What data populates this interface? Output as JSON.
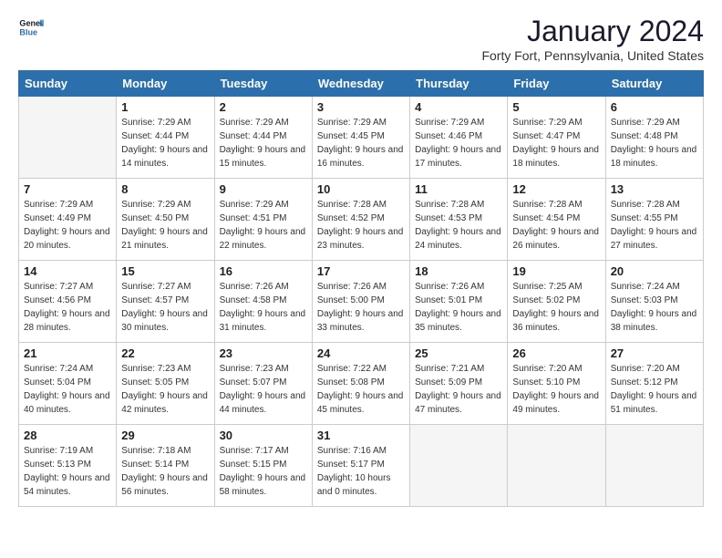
{
  "logo": {
    "line1": "General",
    "line2": "Blue"
  },
  "title": "January 2024",
  "location": "Forty Fort, Pennsylvania, United States",
  "days_of_week": [
    "Sunday",
    "Monday",
    "Tuesday",
    "Wednesday",
    "Thursday",
    "Friday",
    "Saturday"
  ],
  "weeks": [
    [
      {
        "day": "",
        "sunrise": "",
        "sunset": "",
        "daylight": ""
      },
      {
        "day": "1",
        "sunrise": "Sunrise: 7:29 AM",
        "sunset": "Sunset: 4:44 PM",
        "daylight": "Daylight: 9 hours and 14 minutes."
      },
      {
        "day": "2",
        "sunrise": "Sunrise: 7:29 AM",
        "sunset": "Sunset: 4:44 PM",
        "daylight": "Daylight: 9 hours and 15 minutes."
      },
      {
        "day": "3",
        "sunrise": "Sunrise: 7:29 AM",
        "sunset": "Sunset: 4:45 PM",
        "daylight": "Daylight: 9 hours and 16 minutes."
      },
      {
        "day": "4",
        "sunrise": "Sunrise: 7:29 AM",
        "sunset": "Sunset: 4:46 PM",
        "daylight": "Daylight: 9 hours and 17 minutes."
      },
      {
        "day": "5",
        "sunrise": "Sunrise: 7:29 AM",
        "sunset": "Sunset: 4:47 PM",
        "daylight": "Daylight: 9 hours and 18 minutes."
      },
      {
        "day": "6",
        "sunrise": "Sunrise: 7:29 AM",
        "sunset": "Sunset: 4:48 PM",
        "daylight": "Daylight: 9 hours and 18 minutes."
      }
    ],
    [
      {
        "day": "7",
        "sunrise": "Sunrise: 7:29 AM",
        "sunset": "Sunset: 4:49 PM",
        "daylight": "Daylight: 9 hours and 20 minutes."
      },
      {
        "day": "8",
        "sunrise": "Sunrise: 7:29 AM",
        "sunset": "Sunset: 4:50 PM",
        "daylight": "Daylight: 9 hours and 21 minutes."
      },
      {
        "day": "9",
        "sunrise": "Sunrise: 7:29 AM",
        "sunset": "Sunset: 4:51 PM",
        "daylight": "Daylight: 9 hours and 22 minutes."
      },
      {
        "day": "10",
        "sunrise": "Sunrise: 7:28 AM",
        "sunset": "Sunset: 4:52 PM",
        "daylight": "Daylight: 9 hours and 23 minutes."
      },
      {
        "day": "11",
        "sunrise": "Sunrise: 7:28 AM",
        "sunset": "Sunset: 4:53 PM",
        "daylight": "Daylight: 9 hours and 24 minutes."
      },
      {
        "day": "12",
        "sunrise": "Sunrise: 7:28 AM",
        "sunset": "Sunset: 4:54 PM",
        "daylight": "Daylight: 9 hours and 26 minutes."
      },
      {
        "day": "13",
        "sunrise": "Sunrise: 7:28 AM",
        "sunset": "Sunset: 4:55 PM",
        "daylight": "Daylight: 9 hours and 27 minutes."
      }
    ],
    [
      {
        "day": "14",
        "sunrise": "Sunrise: 7:27 AM",
        "sunset": "Sunset: 4:56 PM",
        "daylight": "Daylight: 9 hours and 28 minutes."
      },
      {
        "day": "15",
        "sunrise": "Sunrise: 7:27 AM",
        "sunset": "Sunset: 4:57 PM",
        "daylight": "Daylight: 9 hours and 30 minutes."
      },
      {
        "day": "16",
        "sunrise": "Sunrise: 7:26 AM",
        "sunset": "Sunset: 4:58 PM",
        "daylight": "Daylight: 9 hours and 31 minutes."
      },
      {
        "day": "17",
        "sunrise": "Sunrise: 7:26 AM",
        "sunset": "Sunset: 5:00 PM",
        "daylight": "Daylight: 9 hours and 33 minutes."
      },
      {
        "day": "18",
        "sunrise": "Sunrise: 7:26 AM",
        "sunset": "Sunset: 5:01 PM",
        "daylight": "Daylight: 9 hours and 35 minutes."
      },
      {
        "day": "19",
        "sunrise": "Sunrise: 7:25 AM",
        "sunset": "Sunset: 5:02 PM",
        "daylight": "Daylight: 9 hours and 36 minutes."
      },
      {
        "day": "20",
        "sunrise": "Sunrise: 7:24 AM",
        "sunset": "Sunset: 5:03 PM",
        "daylight": "Daylight: 9 hours and 38 minutes."
      }
    ],
    [
      {
        "day": "21",
        "sunrise": "Sunrise: 7:24 AM",
        "sunset": "Sunset: 5:04 PM",
        "daylight": "Daylight: 9 hours and 40 minutes."
      },
      {
        "day": "22",
        "sunrise": "Sunrise: 7:23 AM",
        "sunset": "Sunset: 5:05 PM",
        "daylight": "Daylight: 9 hours and 42 minutes."
      },
      {
        "day": "23",
        "sunrise": "Sunrise: 7:23 AM",
        "sunset": "Sunset: 5:07 PM",
        "daylight": "Daylight: 9 hours and 44 minutes."
      },
      {
        "day": "24",
        "sunrise": "Sunrise: 7:22 AM",
        "sunset": "Sunset: 5:08 PM",
        "daylight": "Daylight: 9 hours and 45 minutes."
      },
      {
        "day": "25",
        "sunrise": "Sunrise: 7:21 AM",
        "sunset": "Sunset: 5:09 PM",
        "daylight": "Daylight: 9 hours and 47 minutes."
      },
      {
        "day": "26",
        "sunrise": "Sunrise: 7:20 AM",
        "sunset": "Sunset: 5:10 PM",
        "daylight": "Daylight: 9 hours and 49 minutes."
      },
      {
        "day": "27",
        "sunrise": "Sunrise: 7:20 AM",
        "sunset": "Sunset: 5:12 PM",
        "daylight": "Daylight: 9 hours and 51 minutes."
      }
    ],
    [
      {
        "day": "28",
        "sunrise": "Sunrise: 7:19 AM",
        "sunset": "Sunset: 5:13 PM",
        "daylight": "Daylight: 9 hours and 54 minutes."
      },
      {
        "day": "29",
        "sunrise": "Sunrise: 7:18 AM",
        "sunset": "Sunset: 5:14 PM",
        "daylight": "Daylight: 9 hours and 56 minutes."
      },
      {
        "day": "30",
        "sunrise": "Sunrise: 7:17 AM",
        "sunset": "Sunset: 5:15 PM",
        "daylight": "Daylight: 9 hours and 58 minutes."
      },
      {
        "day": "31",
        "sunrise": "Sunrise: 7:16 AM",
        "sunset": "Sunset: 5:17 PM",
        "daylight": "Daylight: 10 hours and 0 minutes."
      },
      {
        "day": "",
        "sunrise": "",
        "sunset": "",
        "daylight": ""
      },
      {
        "day": "",
        "sunrise": "",
        "sunset": "",
        "daylight": ""
      },
      {
        "day": "",
        "sunrise": "",
        "sunset": "",
        "daylight": ""
      }
    ]
  ]
}
